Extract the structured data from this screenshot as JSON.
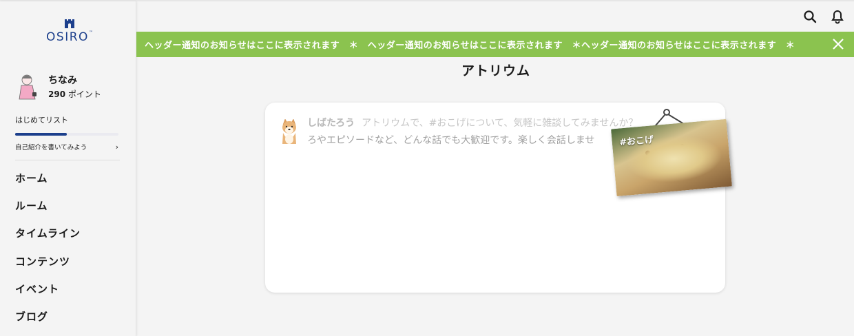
{
  "brand": {
    "name": "OSIRO",
    "trademark": "™"
  },
  "profile": {
    "name": "ちなみ",
    "points_value": "290",
    "points_unit": "ポイント"
  },
  "checklist": {
    "title": "はじめてリスト",
    "progress": 0.5,
    "task": "自己紹介を書いてみよう",
    "chevron": "›"
  },
  "nav": {
    "items": [
      {
        "label": "ホーム"
      },
      {
        "label": "ルーム"
      },
      {
        "label": "タイムライン"
      },
      {
        "label": "コンテンツ"
      },
      {
        "label": "イベント"
      },
      {
        "label": "ブログ"
      }
    ]
  },
  "header": {
    "icons": [
      "search-icon",
      "bell-icon"
    ]
  },
  "banner": {
    "text": "ヘッダー通知のお知らせはここに表示されます　＊　ヘッダー通知のお知らせはここに表示されます　＊ヘッダー通知のお知らせはここに表示されます　＊",
    "background": "#8bc34f"
  },
  "page": {
    "title": "アトリウム"
  },
  "post": {
    "author": "しばたろう",
    "line1": "アトリウムで、#おこげについて、気軽に雑談してみませんか？",
    "line2": "ろやエピソードなど、どんな話でも大歓迎です。楽しく会話しませ"
  },
  "tag": {
    "label": "#おこげ"
  },
  "colors": {
    "brand_blue": "#1c3f8c",
    "accent_green": "#8bc34f"
  }
}
